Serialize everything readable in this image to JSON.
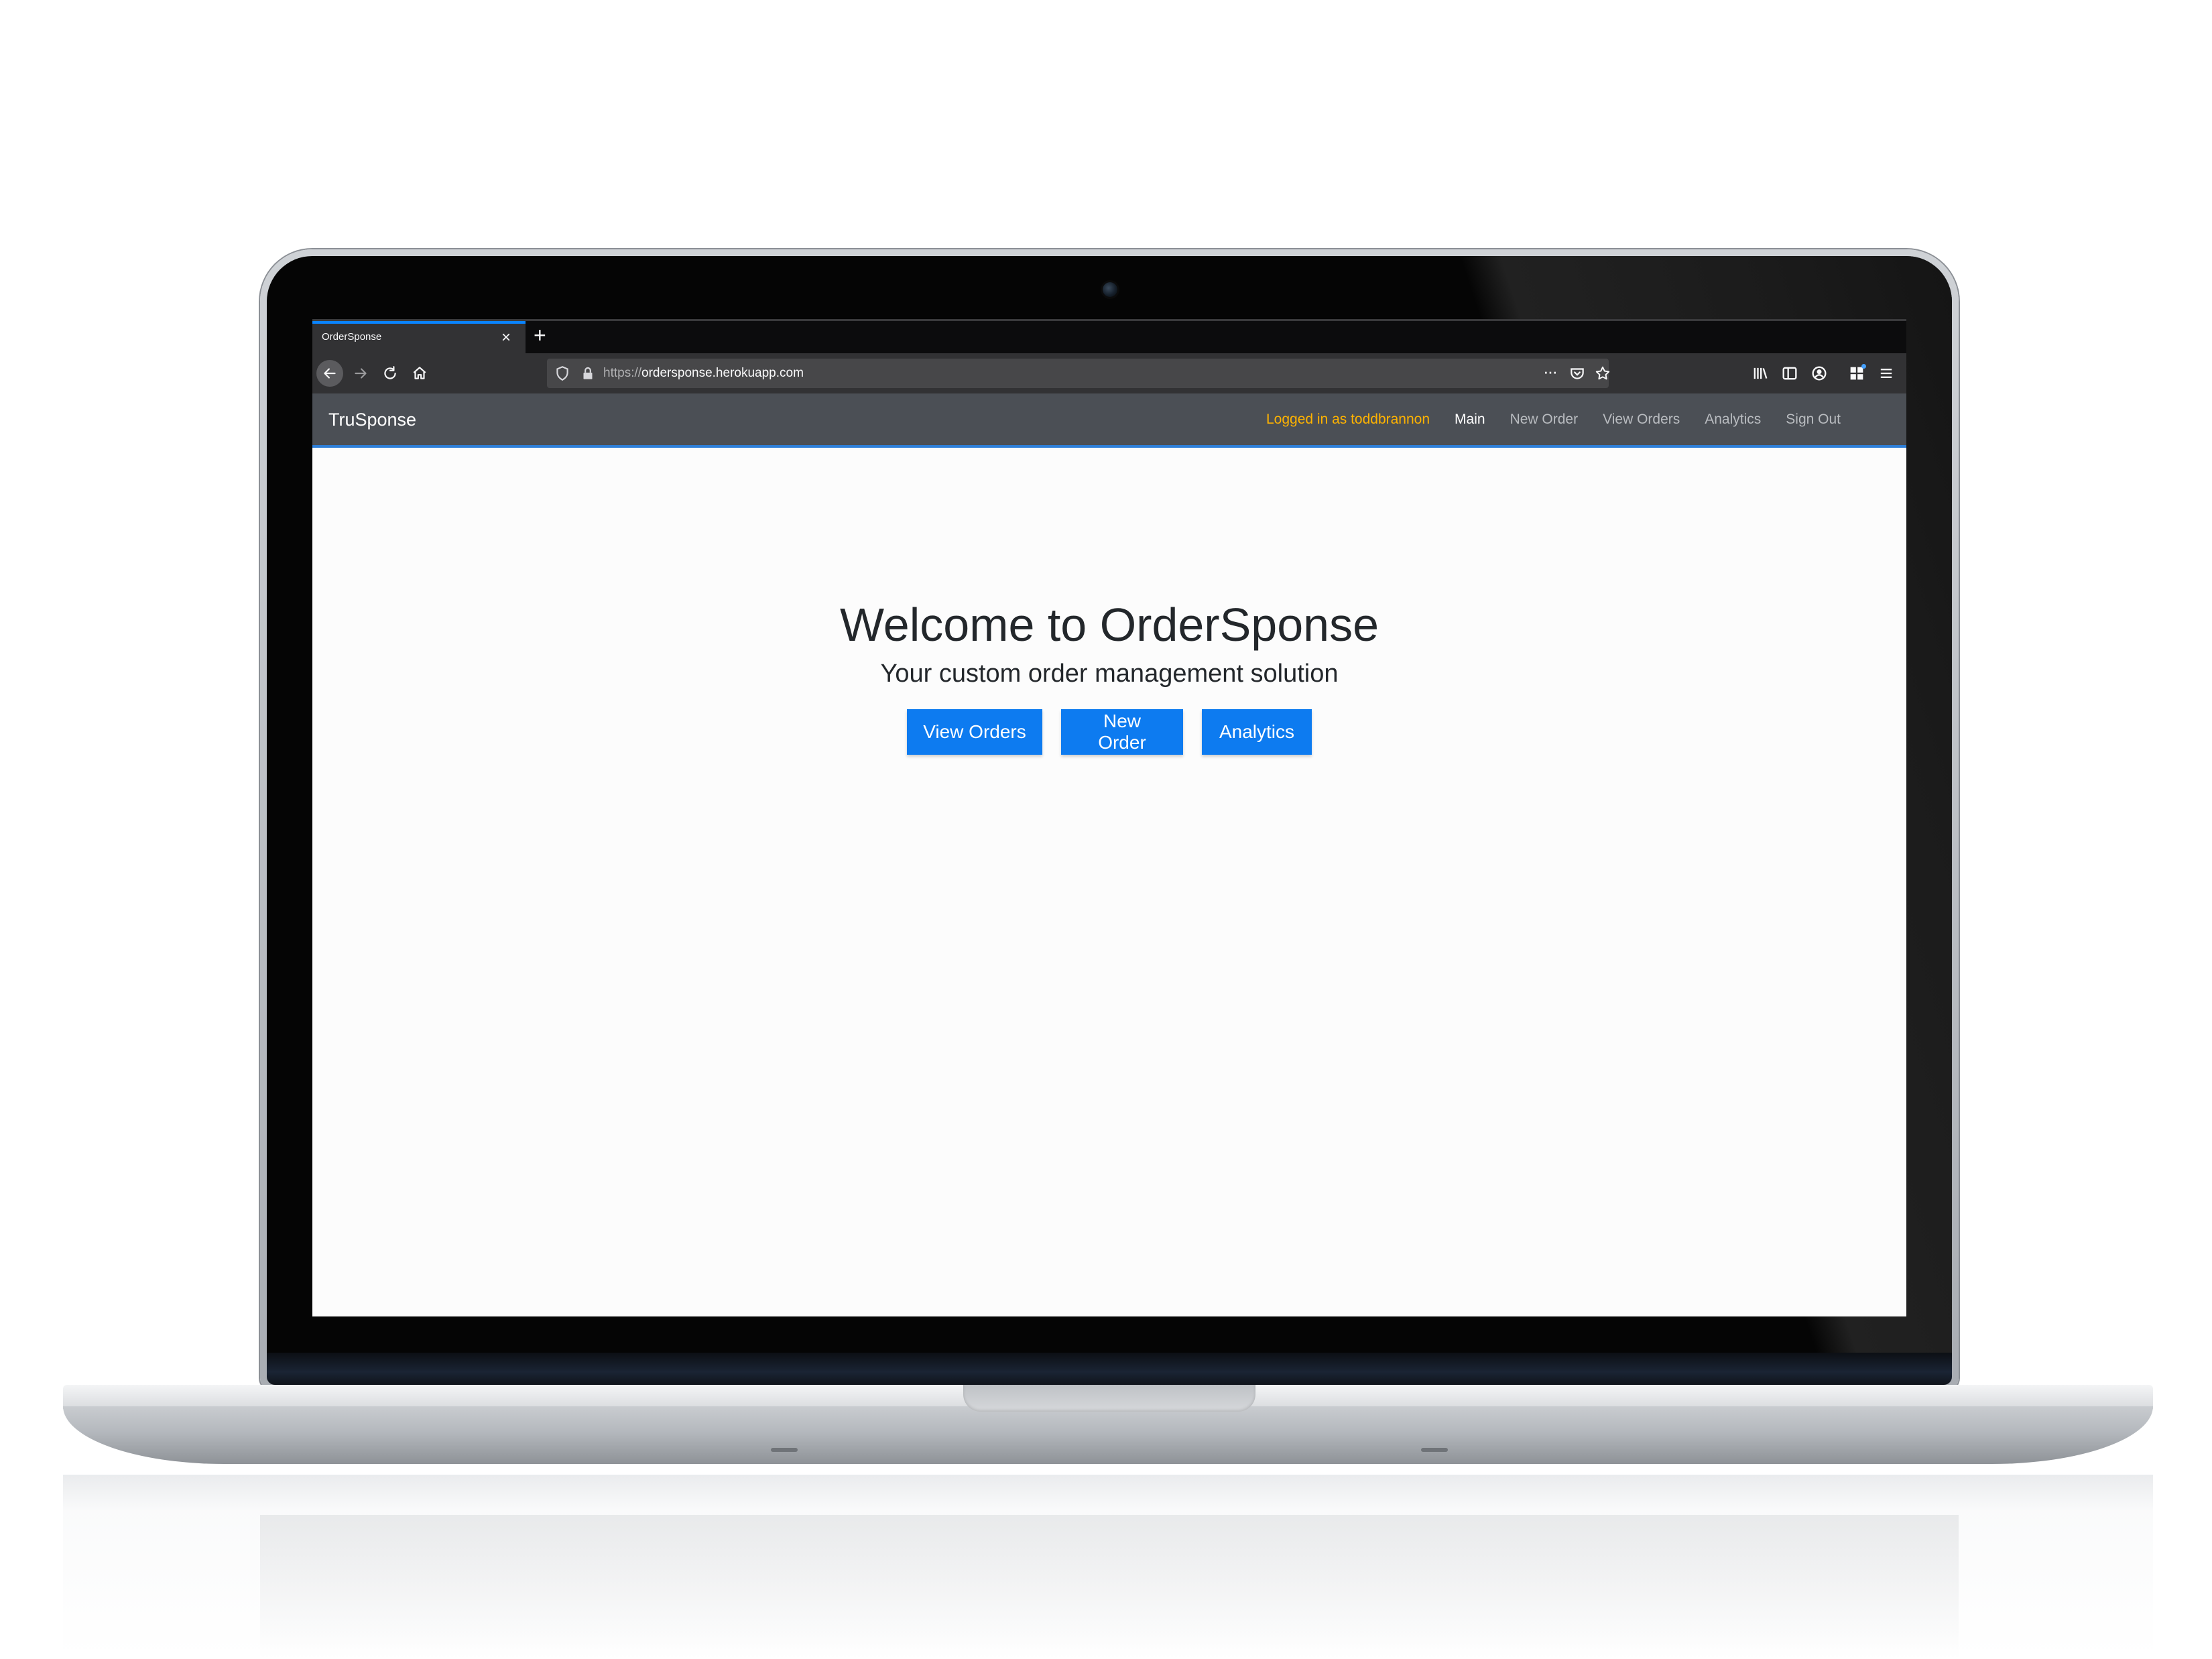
{
  "browser": {
    "tab_title": "OrderSponse",
    "tab_close": "×",
    "new_tab": "+",
    "url_scheme": "https://",
    "url_host": "ordersponse.herokuapp.com",
    "url_more": "···"
  },
  "app": {
    "brand": "TruSponse",
    "logged_in": "Logged in as toddbrannon",
    "nav": [
      "Main",
      "New Order",
      "View Orders",
      "Analytics",
      "Sign Out"
    ],
    "active_nav": "Main",
    "colors": {
      "navbar": "#4b4f55",
      "accent_logged": "#ffb300",
      "button": "#0d7bf0",
      "navbar_border": "#2e7fd8"
    }
  },
  "hero": {
    "title": "Welcome to OrderSponse",
    "subtitle": "Your custom order management solution",
    "buttons": [
      "View Orders",
      "New Order",
      "Analytics"
    ]
  },
  "icons": {
    "tab": [
      "close-icon",
      "plus-icon"
    ],
    "navigation": [
      "back-arrow-icon",
      "forward-arrow-icon",
      "reload-icon",
      "home-icon"
    ],
    "urlbar": [
      "shield-icon",
      "lock-icon",
      "more-icon",
      "pocket-icon",
      "star-icon"
    ],
    "toolbar": [
      "library-icon",
      "sidebar-icon",
      "account-icon",
      "extensions-icon",
      "hamburger-menu-icon"
    ]
  }
}
